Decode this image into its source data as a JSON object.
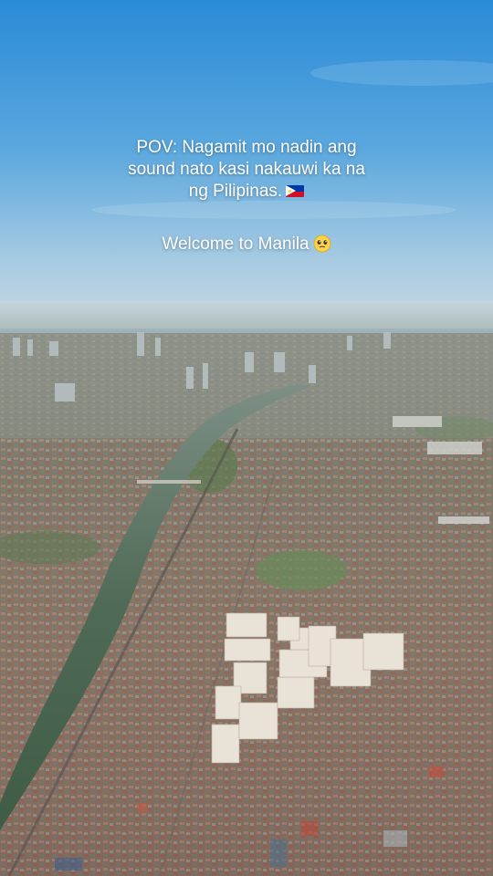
{
  "caption": {
    "line1": "POV: Nagamit mo nadin ang",
    "line2": "sound nato kasi nakauwi ka na",
    "line3": "ng Pilipinas.",
    "line4": "Welcome to Manila"
  },
  "icons": {
    "line3_icon": "philippines-flag-icon",
    "line4_icon": "teary-smiling-face-icon"
  },
  "colors": {
    "sky_top": "#2d8ed8",
    "sky_horizon": "#bcd3e1",
    "river": "#4d6a52",
    "city": "#8a7a6a"
  }
}
